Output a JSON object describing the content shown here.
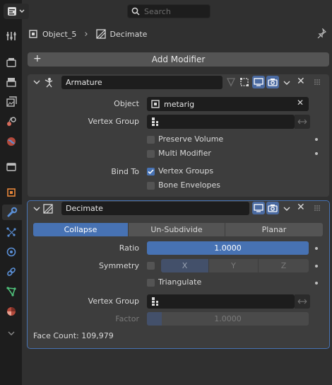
{
  "header": {
    "search_placeholder": "Search"
  },
  "breadcrumb": {
    "object": "Object_5",
    "modifier": "Decimate"
  },
  "add_modifier_label": "Add Modifier",
  "armature": {
    "name": "Armature",
    "object_label": "Object",
    "object_value": "metarig",
    "vertex_group_label": "Vertex Group",
    "preserve_volume": "Preserve Volume",
    "multi_modifier": "Multi Modifier",
    "bind_to_label": "Bind To",
    "vertex_groups": "Vertex Groups",
    "bone_envelopes": "Bone Envelopes"
  },
  "decimate": {
    "name": "Decimate",
    "tabs": [
      "Collapse",
      "Un-Subdivide",
      "Planar"
    ],
    "ratio_label": "Ratio",
    "ratio_value": "1.0000",
    "symmetry_label": "Symmetry",
    "axes": [
      "X",
      "Y",
      "Z"
    ],
    "triangulate": "Triangulate",
    "vertex_group_label": "Vertex Group",
    "factor_label": "Factor",
    "factor_value": "1.0000",
    "face_count": "Face Count: 109,979"
  },
  "colors": {
    "accent": "#4772b3",
    "panel": "#3d3d3d",
    "background": "#303030",
    "sidebar": "#1d1d1d"
  }
}
